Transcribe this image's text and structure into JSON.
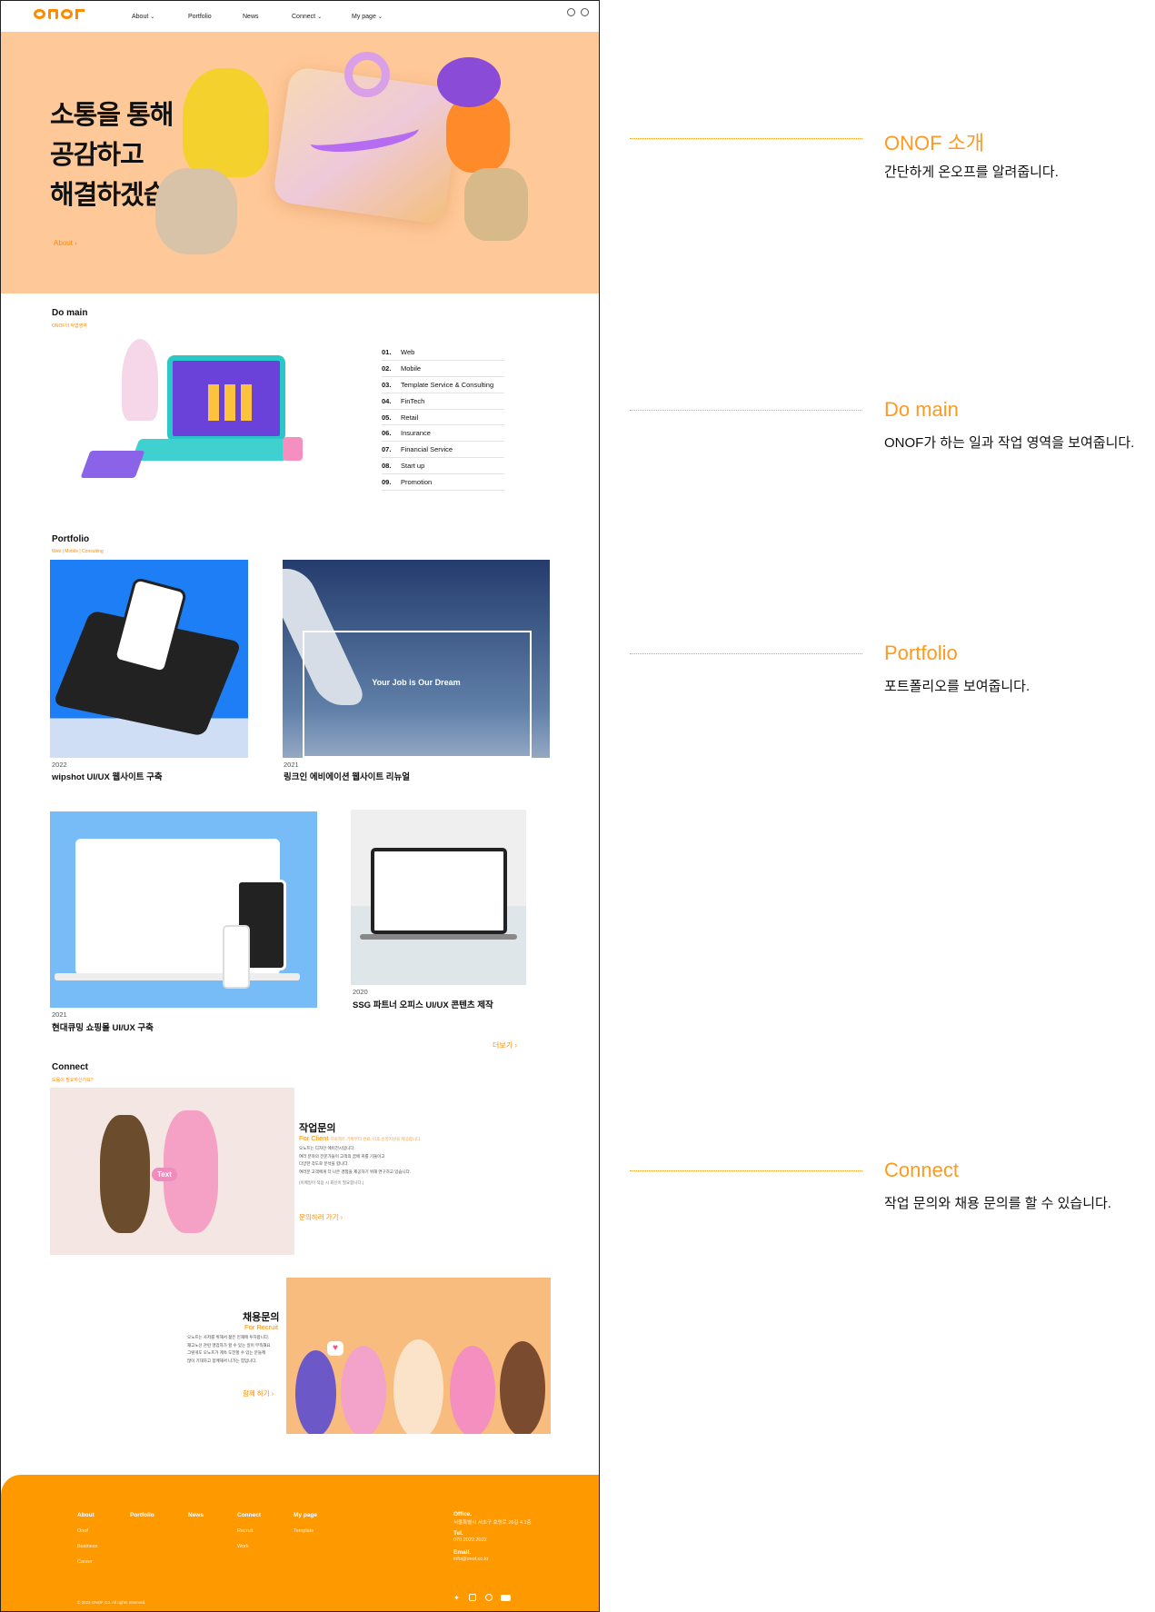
{
  "header": {
    "nav": [
      {
        "label": "About",
        "dropdown": true
      },
      {
        "label": "Portfolio",
        "dropdown": false
      },
      {
        "label": "News",
        "dropdown": false
      },
      {
        "label": "Connect",
        "dropdown": true
      },
      {
        "label": "My page",
        "dropdown": true
      }
    ],
    "icons": [
      "globe-icon",
      "user-icon"
    ]
  },
  "hero": {
    "title_lines": [
      "소통을 통해",
      "공감하고",
      "해결하겠습니다."
    ],
    "link": "About"
  },
  "domain": {
    "title": "Do main",
    "subtitle": "ONOF의 작업영역",
    "items": [
      {
        "num": "01.",
        "label": "Web"
      },
      {
        "num": "02.",
        "label": "Mobile"
      },
      {
        "num": "03.",
        "label": "Template Service & Consulting"
      },
      {
        "num": "04.",
        "label": "FinTech"
      },
      {
        "num": "05.",
        "label": "Retail"
      },
      {
        "num": "06.",
        "label": "Insurance"
      },
      {
        "num": "07.",
        "label": "Financial Service"
      },
      {
        "num": "08.",
        "label": "Start up"
      },
      {
        "num": "09.",
        "label": "Promotion"
      }
    ]
  },
  "portfolio": {
    "title": "Portfolio",
    "subtitle": "Web | Mobile | Consulting",
    "items": [
      {
        "year": "2022",
        "title": "wipshot UI/UX 웹사이트 구축"
      },
      {
        "year": "2021",
        "title": "링크인 에비에이션 웹사이트 리뉴얼",
        "screen_text": "Your Job is Our Dream"
      },
      {
        "year": "2021",
        "title": "현대큐밍 쇼핑몰 UI/UX 구축"
      },
      {
        "year": "2020",
        "title": "SSG 파트너 오피스 UI/UX 콘텐츠 제작"
      }
    ],
    "more": "더보기"
  },
  "connect": {
    "title": "Connect",
    "subtitle": "도움이 필요하신가요?",
    "client": {
      "title": "작업문의",
      "sub": "For Client",
      "sub_note": "프로젝트 기획부터 완료, 이후 운영지원을 제공합니다.",
      "lines": [
        "오노프는 디자인 에이전시입니다.",
        "여러 분야의 전문가들이 고객의 꿈에 귀를 기울이고",
        "다양한 각도로 분석을 합니다.",
        "여러분 고객에게 더 나은 경험을 제공하기 위해 연구하고 있습니다."
      ],
      "note": "(이메일이 적용 시 회신이 필요합니다.)",
      "link": "문의하러 가기"
    },
    "recruit": {
      "title": "채용문의",
      "sub": "For Recruit",
      "lines": [
        "오노프는 사저를 위해서 젊은 인재에 투자합니다.",
        "재고노선 관련 영업자가 할 수 있는 일이 부족해요",
        "그렇게도 오노프가 계속 도전할 수 있는 분들께",
        "많이 기대하고 함께해서 나가는 힘입니다."
      ],
      "link": "함께 하기"
    },
    "badge": "Text"
  },
  "footer": {
    "cols": [
      {
        "title": "About",
        "items": [
          "Onof",
          "Business",
          "Career"
        ]
      },
      {
        "title": "Portfolio",
        "items": []
      },
      {
        "title": "News",
        "items": []
      },
      {
        "title": "Connect",
        "items": [
          "Recruit",
          "Work"
        ]
      },
      {
        "title": "My page",
        "items": [
          "Template"
        ]
      }
    ],
    "office_label": "Office.",
    "office": "서울특별시 서초구 효령로 26길 4 1층",
    "tel_label": "Tel.",
    "tel": "070.2022.2022",
    "email_label": "Email.",
    "email": "info@onof.co.kr",
    "copyright": "© 2022 ONOF Co. All rights reserved.",
    "social": [
      "twitter-icon",
      "instagram-icon",
      "facebook-icon",
      "youtube-icon"
    ]
  },
  "annotations": [
    {
      "title": "ONOF 소개",
      "desc": "간단하게 온오프를 알려줍니다."
    },
    {
      "title": "Do main",
      "desc": "ONOF가 하는 일과 작업 영역을 보여줍니다."
    },
    {
      "title": "Portfolio",
      "desc": "포트폴리오를 보여줍니다."
    },
    {
      "title": "Connect",
      "desc": "작업 문의와 채용 문의를 할 수 있습니다."
    }
  ],
  "colors": {
    "accent": "#ff9900",
    "hero_bg": "#ffc898"
  }
}
